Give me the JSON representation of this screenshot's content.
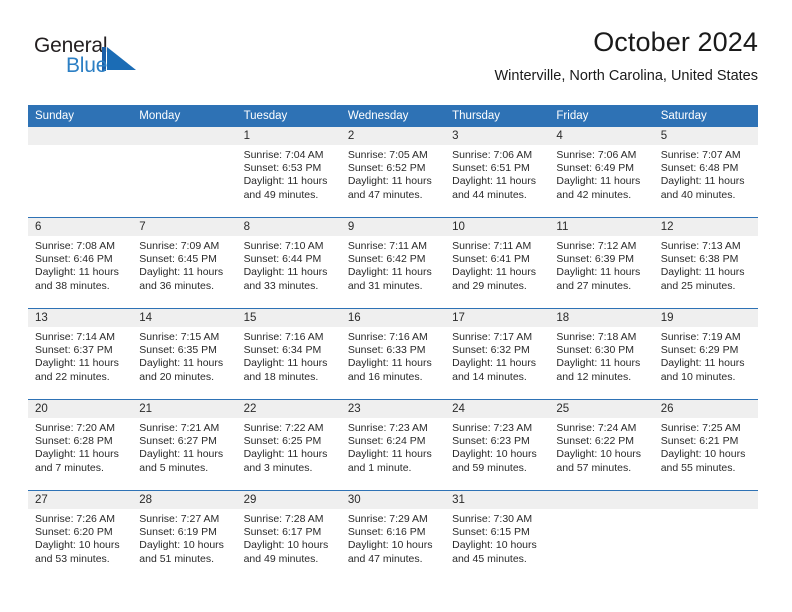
{
  "brand": {
    "name_top": "General",
    "name_bottom": "Blue",
    "accent_color": "#2c7fc4",
    "text_color": "#231f20"
  },
  "header": {
    "title": "October 2024",
    "subtitle": "Winterville, North Carolina, United States"
  },
  "theme": {
    "header_blue": "#2e72b5",
    "daynum_band": "#efefef",
    "body_text": "#2a2a2a"
  },
  "weekday_headers": [
    "Sunday",
    "Monday",
    "Tuesday",
    "Wednesday",
    "Thursday",
    "Friday",
    "Saturday"
  ],
  "weeks": [
    [
      {
        "day": "",
        "sunrise": "",
        "sunset": "",
        "daylight": "",
        "empty": true
      },
      {
        "day": "",
        "sunrise": "",
        "sunset": "",
        "daylight": "",
        "empty": true
      },
      {
        "day": "1",
        "sunrise": "Sunrise: 7:04 AM",
        "sunset": "Sunset: 6:53 PM",
        "daylight": "Daylight: 11 hours and 49 minutes."
      },
      {
        "day": "2",
        "sunrise": "Sunrise: 7:05 AM",
        "sunset": "Sunset: 6:52 PM",
        "daylight": "Daylight: 11 hours and 47 minutes."
      },
      {
        "day": "3",
        "sunrise": "Sunrise: 7:06 AM",
        "sunset": "Sunset: 6:51 PM",
        "daylight": "Daylight: 11 hours and 44 minutes."
      },
      {
        "day": "4",
        "sunrise": "Sunrise: 7:06 AM",
        "sunset": "Sunset: 6:49 PM",
        "daylight": "Daylight: 11 hours and 42 minutes."
      },
      {
        "day": "5",
        "sunrise": "Sunrise: 7:07 AM",
        "sunset": "Sunset: 6:48 PM",
        "daylight": "Daylight: 11 hours and 40 minutes."
      }
    ],
    [
      {
        "day": "6",
        "sunrise": "Sunrise: 7:08 AM",
        "sunset": "Sunset: 6:46 PM",
        "daylight": "Daylight: 11 hours and 38 minutes."
      },
      {
        "day": "7",
        "sunrise": "Sunrise: 7:09 AM",
        "sunset": "Sunset: 6:45 PM",
        "daylight": "Daylight: 11 hours and 36 minutes."
      },
      {
        "day": "8",
        "sunrise": "Sunrise: 7:10 AM",
        "sunset": "Sunset: 6:44 PM",
        "daylight": "Daylight: 11 hours and 33 minutes."
      },
      {
        "day": "9",
        "sunrise": "Sunrise: 7:11 AM",
        "sunset": "Sunset: 6:42 PM",
        "daylight": "Daylight: 11 hours and 31 minutes."
      },
      {
        "day": "10",
        "sunrise": "Sunrise: 7:11 AM",
        "sunset": "Sunset: 6:41 PM",
        "daylight": "Daylight: 11 hours and 29 minutes."
      },
      {
        "day": "11",
        "sunrise": "Sunrise: 7:12 AM",
        "sunset": "Sunset: 6:39 PM",
        "daylight": "Daylight: 11 hours and 27 minutes."
      },
      {
        "day": "12",
        "sunrise": "Sunrise: 7:13 AM",
        "sunset": "Sunset: 6:38 PM",
        "daylight": "Daylight: 11 hours and 25 minutes."
      }
    ],
    [
      {
        "day": "13",
        "sunrise": "Sunrise: 7:14 AM",
        "sunset": "Sunset: 6:37 PM",
        "daylight": "Daylight: 11 hours and 22 minutes."
      },
      {
        "day": "14",
        "sunrise": "Sunrise: 7:15 AM",
        "sunset": "Sunset: 6:35 PM",
        "daylight": "Daylight: 11 hours and 20 minutes."
      },
      {
        "day": "15",
        "sunrise": "Sunrise: 7:16 AM",
        "sunset": "Sunset: 6:34 PM",
        "daylight": "Daylight: 11 hours and 18 minutes."
      },
      {
        "day": "16",
        "sunrise": "Sunrise: 7:16 AM",
        "sunset": "Sunset: 6:33 PM",
        "daylight": "Daylight: 11 hours and 16 minutes."
      },
      {
        "day": "17",
        "sunrise": "Sunrise: 7:17 AM",
        "sunset": "Sunset: 6:32 PM",
        "daylight": "Daylight: 11 hours and 14 minutes."
      },
      {
        "day": "18",
        "sunrise": "Sunrise: 7:18 AM",
        "sunset": "Sunset: 6:30 PM",
        "daylight": "Daylight: 11 hours and 12 minutes."
      },
      {
        "day": "19",
        "sunrise": "Sunrise: 7:19 AM",
        "sunset": "Sunset: 6:29 PM",
        "daylight": "Daylight: 11 hours and 10 minutes."
      }
    ],
    [
      {
        "day": "20",
        "sunrise": "Sunrise: 7:20 AM",
        "sunset": "Sunset: 6:28 PM",
        "daylight": "Daylight: 11 hours and 7 minutes."
      },
      {
        "day": "21",
        "sunrise": "Sunrise: 7:21 AM",
        "sunset": "Sunset: 6:27 PM",
        "daylight": "Daylight: 11 hours and 5 minutes."
      },
      {
        "day": "22",
        "sunrise": "Sunrise: 7:22 AM",
        "sunset": "Sunset: 6:25 PM",
        "daylight": "Daylight: 11 hours and 3 minutes."
      },
      {
        "day": "23",
        "sunrise": "Sunrise: 7:23 AM",
        "sunset": "Sunset: 6:24 PM",
        "daylight": "Daylight: 11 hours and 1 minute."
      },
      {
        "day": "24",
        "sunrise": "Sunrise: 7:23 AM",
        "sunset": "Sunset: 6:23 PM",
        "daylight": "Daylight: 10 hours and 59 minutes."
      },
      {
        "day": "25",
        "sunrise": "Sunrise: 7:24 AM",
        "sunset": "Sunset: 6:22 PM",
        "daylight": "Daylight: 10 hours and 57 minutes."
      },
      {
        "day": "26",
        "sunrise": "Sunrise: 7:25 AM",
        "sunset": "Sunset: 6:21 PM",
        "daylight": "Daylight: 10 hours and 55 minutes."
      }
    ],
    [
      {
        "day": "27",
        "sunrise": "Sunrise: 7:26 AM",
        "sunset": "Sunset: 6:20 PM",
        "daylight": "Daylight: 10 hours and 53 minutes."
      },
      {
        "day": "28",
        "sunrise": "Sunrise: 7:27 AM",
        "sunset": "Sunset: 6:19 PM",
        "daylight": "Daylight: 10 hours and 51 minutes."
      },
      {
        "day": "29",
        "sunrise": "Sunrise: 7:28 AM",
        "sunset": "Sunset: 6:17 PM",
        "daylight": "Daylight: 10 hours and 49 minutes."
      },
      {
        "day": "30",
        "sunrise": "Sunrise: 7:29 AM",
        "sunset": "Sunset: 6:16 PM",
        "daylight": "Daylight: 10 hours and 47 minutes."
      },
      {
        "day": "31",
        "sunrise": "Sunrise: 7:30 AM",
        "sunset": "Sunset: 6:15 PM",
        "daylight": "Daylight: 10 hours and 45 minutes."
      },
      {
        "day": "",
        "sunrise": "",
        "sunset": "",
        "daylight": "",
        "empty": true
      },
      {
        "day": "",
        "sunrise": "",
        "sunset": "",
        "daylight": "",
        "empty": true
      }
    ]
  ]
}
